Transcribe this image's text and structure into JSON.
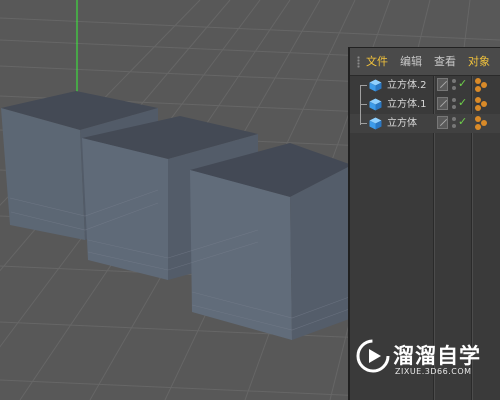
{
  "menubar": {
    "items": [
      {
        "label": "文件",
        "state": "active"
      },
      {
        "label": "编辑",
        "state": "normal"
      },
      {
        "label": "查看",
        "state": "normal"
      },
      {
        "label": "对象",
        "state": "active"
      }
    ]
  },
  "objects": [
    {
      "name": "立方体.2",
      "visible_check": "✓",
      "icon": "cube-icon",
      "tags": "material-tag-icon"
    },
    {
      "name": "立方体.1",
      "visible_check": "✓",
      "icon": "cube-icon",
      "tags": "material-tag-icon"
    },
    {
      "name": "立方体",
      "visible_check": "✓",
      "icon": "cube-icon",
      "tags": "material-tag-icon"
    }
  ],
  "watermark": {
    "title": "溜溜自学",
    "url": "ZIXUE.3D66.COM"
  },
  "colors": {
    "viewport_bg": "#585858",
    "grid": "#666666",
    "cube_top": "#444a55",
    "cube_front": "#5f6a78",
    "cube_side": "#535c69",
    "y_axis": "#3fdc3f",
    "menu_active": "#f2c33c",
    "check": "#6fd04a",
    "cube_icon": "#3d9be9",
    "tag": "#d98a28"
  }
}
